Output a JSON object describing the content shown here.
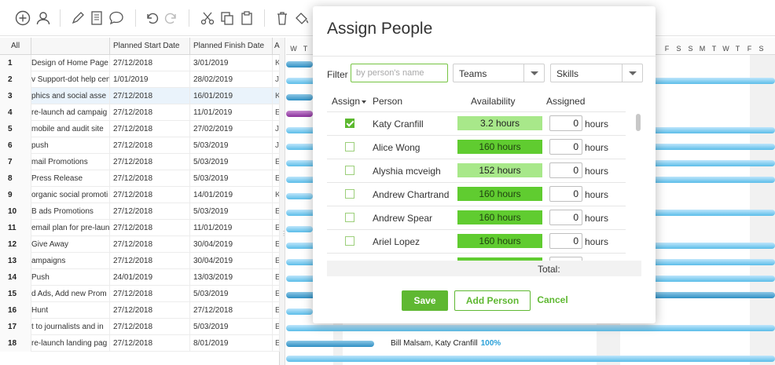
{
  "toolbar": {
    "icons": [
      "add-icon",
      "user-icon",
      "edit-icon",
      "notes-icon",
      "comment-icon",
      "undo-icon",
      "redo-icon",
      "cut-icon",
      "copy-icon",
      "paste-icon",
      "delete-icon",
      "paint-icon"
    ]
  },
  "grid": {
    "headers": {
      "num": "All",
      "name": "",
      "start": "Planned Start Date",
      "finish": "Planned Finish Date",
      "extra": "A"
    },
    "rows": [
      {
        "num": "1",
        "name": "Design of Home Page",
        "start": "27/12/2018",
        "finish": "3/01/2019",
        "extra": "K"
      },
      {
        "num": "2",
        "name": "v Support-dot help cen",
        "start": "1/01/2019",
        "finish": "28/02/2019",
        "extra": "J"
      },
      {
        "num": "3",
        "name": "phics and social asse",
        "start": "27/12/2018",
        "finish": "16/01/2019",
        "extra": "K"
      },
      {
        "num": "4",
        "name": "re-launch ad campaig",
        "start": "27/12/2018",
        "finish": "11/01/2019",
        "extra": "E"
      },
      {
        "num": "5",
        "name": "mobile and audit site",
        "start": "27/12/2018",
        "finish": "27/02/2019",
        "extra": "J"
      },
      {
        "num": "6",
        "name": "push",
        "start": "27/12/2018",
        "finish": "5/03/2019",
        "extra": "J"
      },
      {
        "num": "7",
        "name": "mail Promotions",
        "start": "27/12/2018",
        "finish": "5/03/2019",
        "extra": "E"
      },
      {
        "num": "8",
        "name": "Press Release",
        "start": "27/12/2018",
        "finish": "5/03/2019",
        "extra": "E"
      },
      {
        "num": "9",
        "name": "organic social promoti",
        "start": "27/12/2018",
        "finish": "14/01/2019",
        "extra": "K"
      },
      {
        "num": "10",
        "name": "B ads Promotions",
        "start": "27/12/2018",
        "finish": "5/03/2019",
        "extra": "E"
      },
      {
        "num": "11",
        "name": "email plan for pre-laun",
        "start": "27/12/2018",
        "finish": "11/01/2019",
        "extra": "E"
      },
      {
        "num": "12",
        "name": "Give Away",
        "start": "27/12/2018",
        "finish": "30/04/2019",
        "extra": "E"
      },
      {
        "num": "13",
        "name": "ampaigns",
        "start": "27/12/2018",
        "finish": "30/04/2019",
        "extra": "E"
      },
      {
        "num": "14",
        "name": "Push",
        "start": "24/01/2019",
        "finish": "13/03/2019",
        "extra": "E"
      },
      {
        "num": "15",
        "name": "d Ads, Add new Prom",
        "start": "27/12/2018",
        "finish": "5/03/2019",
        "extra": "E"
      },
      {
        "num": "16",
        "name": "Hunt",
        "start": "27/12/2018",
        "finish": "27/12/2018",
        "extra": "E"
      },
      {
        "num": "17",
        "name": "t to journalists and in",
        "start": "27/12/2018",
        "finish": "5/03/2019",
        "extra": "E"
      },
      {
        "num": "18",
        "name": "re-launch landing pag",
        "start": "27/12/2018",
        "finish": "8/01/2019",
        "extra": "E"
      }
    ]
  },
  "gantt": {
    "days": [
      "W",
      "T",
      "F",
      "S",
      "S",
      "M",
      "T",
      "W",
      "T",
      "F",
      "S"
    ],
    "label": {
      "assignees": "Bill Malsam, Katy Cranfill",
      "pct": "100%"
    }
  },
  "modal": {
    "title": "Assign People",
    "filter_label": "Filter",
    "filter_placeholder": "by person's name",
    "teams_label": "Teams",
    "skills_label": "Skills",
    "col_assign": "Assign",
    "col_person": "Person",
    "col_availability": "Availability",
    "col_assigned": "Assigned",
    "people": [
      {
        "name": "Katy Cranfill",
        "availability": "3.2 hours",
        "assigned": "0",
        "unit": "hours",
        "checked": true,
        "level": "light"
      },
      {
        "name": "Alice Wong",
        "availability": "160 hours",
        "assigned": "0",
        "unit": "hours",
        "checked": false,
        "level": "full"
      },
      {
        "name": "Alyshia mcveigh",
        "availability": "152 hours",
        "assigned": "0",
        "unit": "hours",
        "checked": false,
        "level": "light"
      },
      {
        "name": "Andrew Chartrand",
        "availability": "160 hours",
        "assigned": "0",
        "unit": "hours",
        "checked": false,
        "level": "full"
      },
      {
        "name": "Andrew Spear",
        "availability": "160 hours",
        "assigned": "0",
        "unit": "hours",
        "checked": false,
        "level": "full"
      },
      {
        "name": "Ariel Lopez",
        "availability": "160 hours",
        "assigned": "0",
        "unit": "hours",
        "checked": false,
        "level": "full"
      }
    ],
    "total_label": "Total:",
    "save_label": "Save",
    "add_person_label": "Add Person",
    "cancel_label": "Cancel"
  },
  "colors": {
    "accent": "#5fb832",
    "bar_light": "#5bbde9",
    "selected_row": "#eaf3fb"
  }
}
